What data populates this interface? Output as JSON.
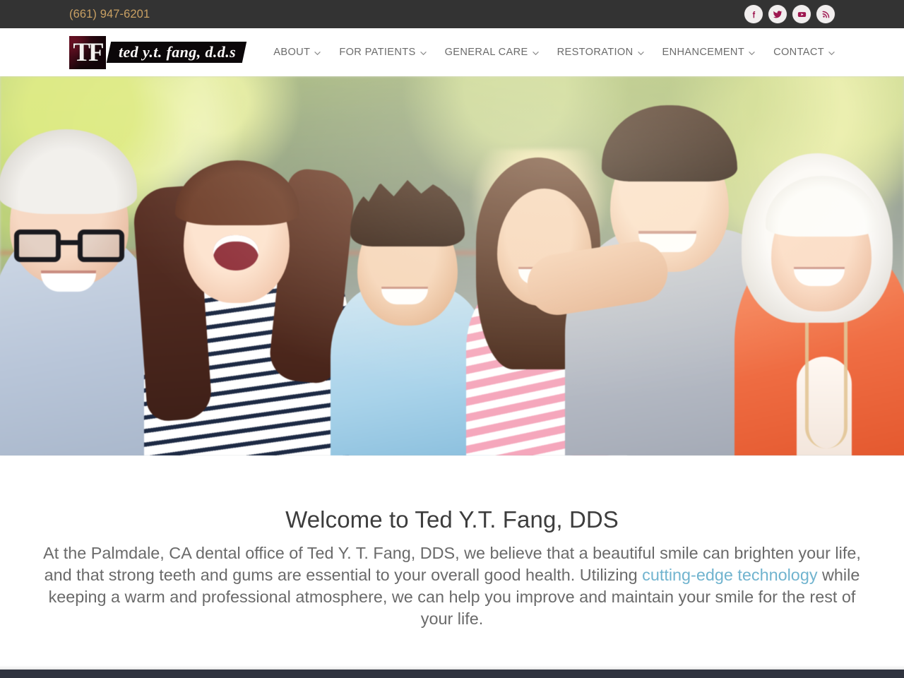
{
  "topbar": {
    "phone": "(661) 947-6201",
    "socials": [
      {
        "name": "facebook-icon",
        "label": "Facebook",
        "glyph": "f"
      },
      {
        "name": "twitter-icon",
        "label": "Twitter",
        "glyph": "t"
      },
      {
        "name": "youtube-icon",
        "label": "YouTube",
        "glyph": "y"
      },
      {
        "name": "rss-icon",
        "label": "RSS",
        "glyph": "r"
      }
    ],
    "background": "#333333",
    "phone_color": "#c9a063",
    "social_glyph_color": "#9e1750"
  },
  "header": {
    "logo": {
      "monogram": "TF",
      "wordmark": "ted y.t. fang, d.d.s"
    },
    "nav": [
      {
        "label": "ABOUT",
        "has_submenu": true
      },
      {
        "label": "FOR PATIENTS",
        "has_submenu": true
      },
      {
        "label": "GENERAL CARE",
        "has_submenu": true
      },
      {
        "label": "RESTORATION",
        "has_submenu": true
      },
      {
        "label": "ENHANCEMENT",
        "has_submenu": true
      },
      {
        "label": "CONTACT",
        "has_submenu": true
      }
    ],
    "nav_text_color": "#6b6b6b"
  },
  "hero": {
    "alt": "Multigenerational family of six smiling outdoors in sunlight"
  },
  "welcome": {
    "heading": "Welcome to Ted Y.T. Fang, DDS",
    "paragraph_part1": "At the Palmdale, CA dental office of Ted Y. T. Fang, DDS, we believe that a beautiful smile can brighten your life, and that strong teeth and gums are essential to your overall good health. Utilizing ",
    "link_text": "cutting-edge technology",
    "paragraph_part2": " while keeping a warm and professional atmosphere, we can help you improve and maintain your smile for the rest of your life.",
    "link_color": "#71b4cf",
    "heading_color": "#3d3d3d",
    "body_color": "#6a6a6a"
  },
  "footer": {
    "background": "#2f333f"
  }
}
